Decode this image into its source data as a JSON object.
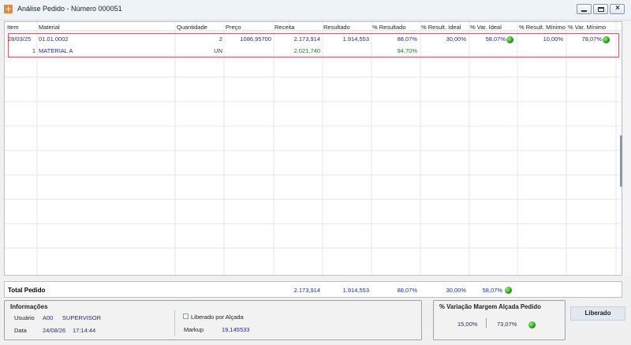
{
  "window": {
    "title": "Análise Pedido - Número 000051"
  },
  "table": {
    "headers": [
      "Item",
      "Material",
      "Quantidade",
      "Preço",
      "Receita",
      "Resultado",
      "% Resultado",
      "% Result. Ideal",
      "% Var. Ideal",
      "% Result. Mínimo",
      "% Var. Mínimo"
    ],
    "rows": [
      {
        "item": "28/03/25",
        "material": "01.01.0002",
        "quantidade": "2",
        "preco": "1086,95700",
        "receita": "2.173,914",
        "resultado": "1.914,553",
        "pct_resultado": "88,07%",
        "pct_result_ideal": "30,00%",
        "pct_var_ideal": "58,07%",
        "pct_result_minimo": "10,00%",
        "pct_var_minimo": "78,07%"
      },
      {
        "item": "1",
        "material": "MATERIAL A",
        "quantidade": "UN",
        "receita": "2.021,740",
        "pct_resultado": "94,70%"
      }
    ]
  },
  "total": {
    "label": "Total Pedido",
    "receita": "2.173,914",
    "resultado": "1.914,553",
    "pct_resultado": "88,07%",
    "pct_result_ideal": "30,00%",
    "pct_var_ideal": "58,07%"
  },
  "info": {
    "title": "Informações",
    "usuario_label": "Usuário",
    "usuario_code": "A00",
    "usuario_name": "SUPERVISOR",
    "data_label": "Data",
    "data_date": "24/08/26",
    "data_time": "17:14:44",
    "liberado_label": "Liberado por Alçada",
    "markup_label": "Markup",
    "markup_value": "19,145533"
  },
  "margin": {
    "title": "% Variação Margem Alçada Pedido",
    "value_left": "15,00%",
    "value_right": "73,07%"
  },
  "status": {
    "label": "Liberado"
  },
  "icons": {
    "app": "app-icon",
    "ok": "green-status-icon"
  }
}
